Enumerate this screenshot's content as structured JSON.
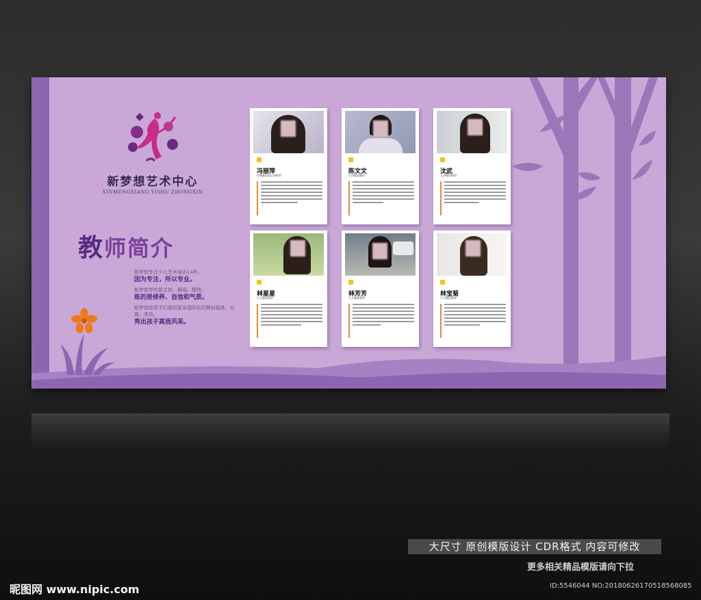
{
  "brand": {
    "name_cn": "新梦想艺术中心",
    "name_en": "XINMENGXIANG YISHU ZHONGXIN"
  },
  "heading": {
    "part1": "教",
    "part2": "师简介"
  },
  "intro": [
    {
      "small": "新梦想专注少儿艺术培训14年，",
      "big": "因为专注，所以专业。"
    },
    {
      "small": "新梦想学的是主持、舞蹈、模特，",
      "big": "练的是修养、自信和气质。"
    },
    {
      "small": "新梦想给孩子们提供更多国际化的舞台锻炼、比赛、秀场，",
      "big": "秀出孩子真我风采。"
    }
  ],
  "teachers": [
    {
      "name": "冯丽萍",
      "role": "任教舞蹈班主讲教师"
    },
    {
      "name": "陈文文",
      "role": "主讲舞蹈教师"
    },
    {
      "name": "沈武",
      "role": "主讲教师模特"
    },
    {
      "name": "林星星",
      "role": "少儿舞蹈教师"
    },
    {
      "name": "林芳芳",
      "role": "少儿舞蹈教师"
    },
    {
      "name": "林宝菊",
      "role": "少儿舞蹈教师"
    }
  ],
  "footer": {
    "promo": "大尺寸 原创模版设计 CDR格式 内容可修改",
    "more": "更多相关精品模版请向下拉",
    "site": "昵图网 www.nipic.com",
    "id": "ID:5546044 NO:20180626170518568085"
  },
  "colors": {
    "board": "#c9a8d8",
    "accent": "#8c66b1",
    "heading": "#7b3f9a",
    "flower": "#f07a1a",
    "tag": "#f0c419"
  }
}
